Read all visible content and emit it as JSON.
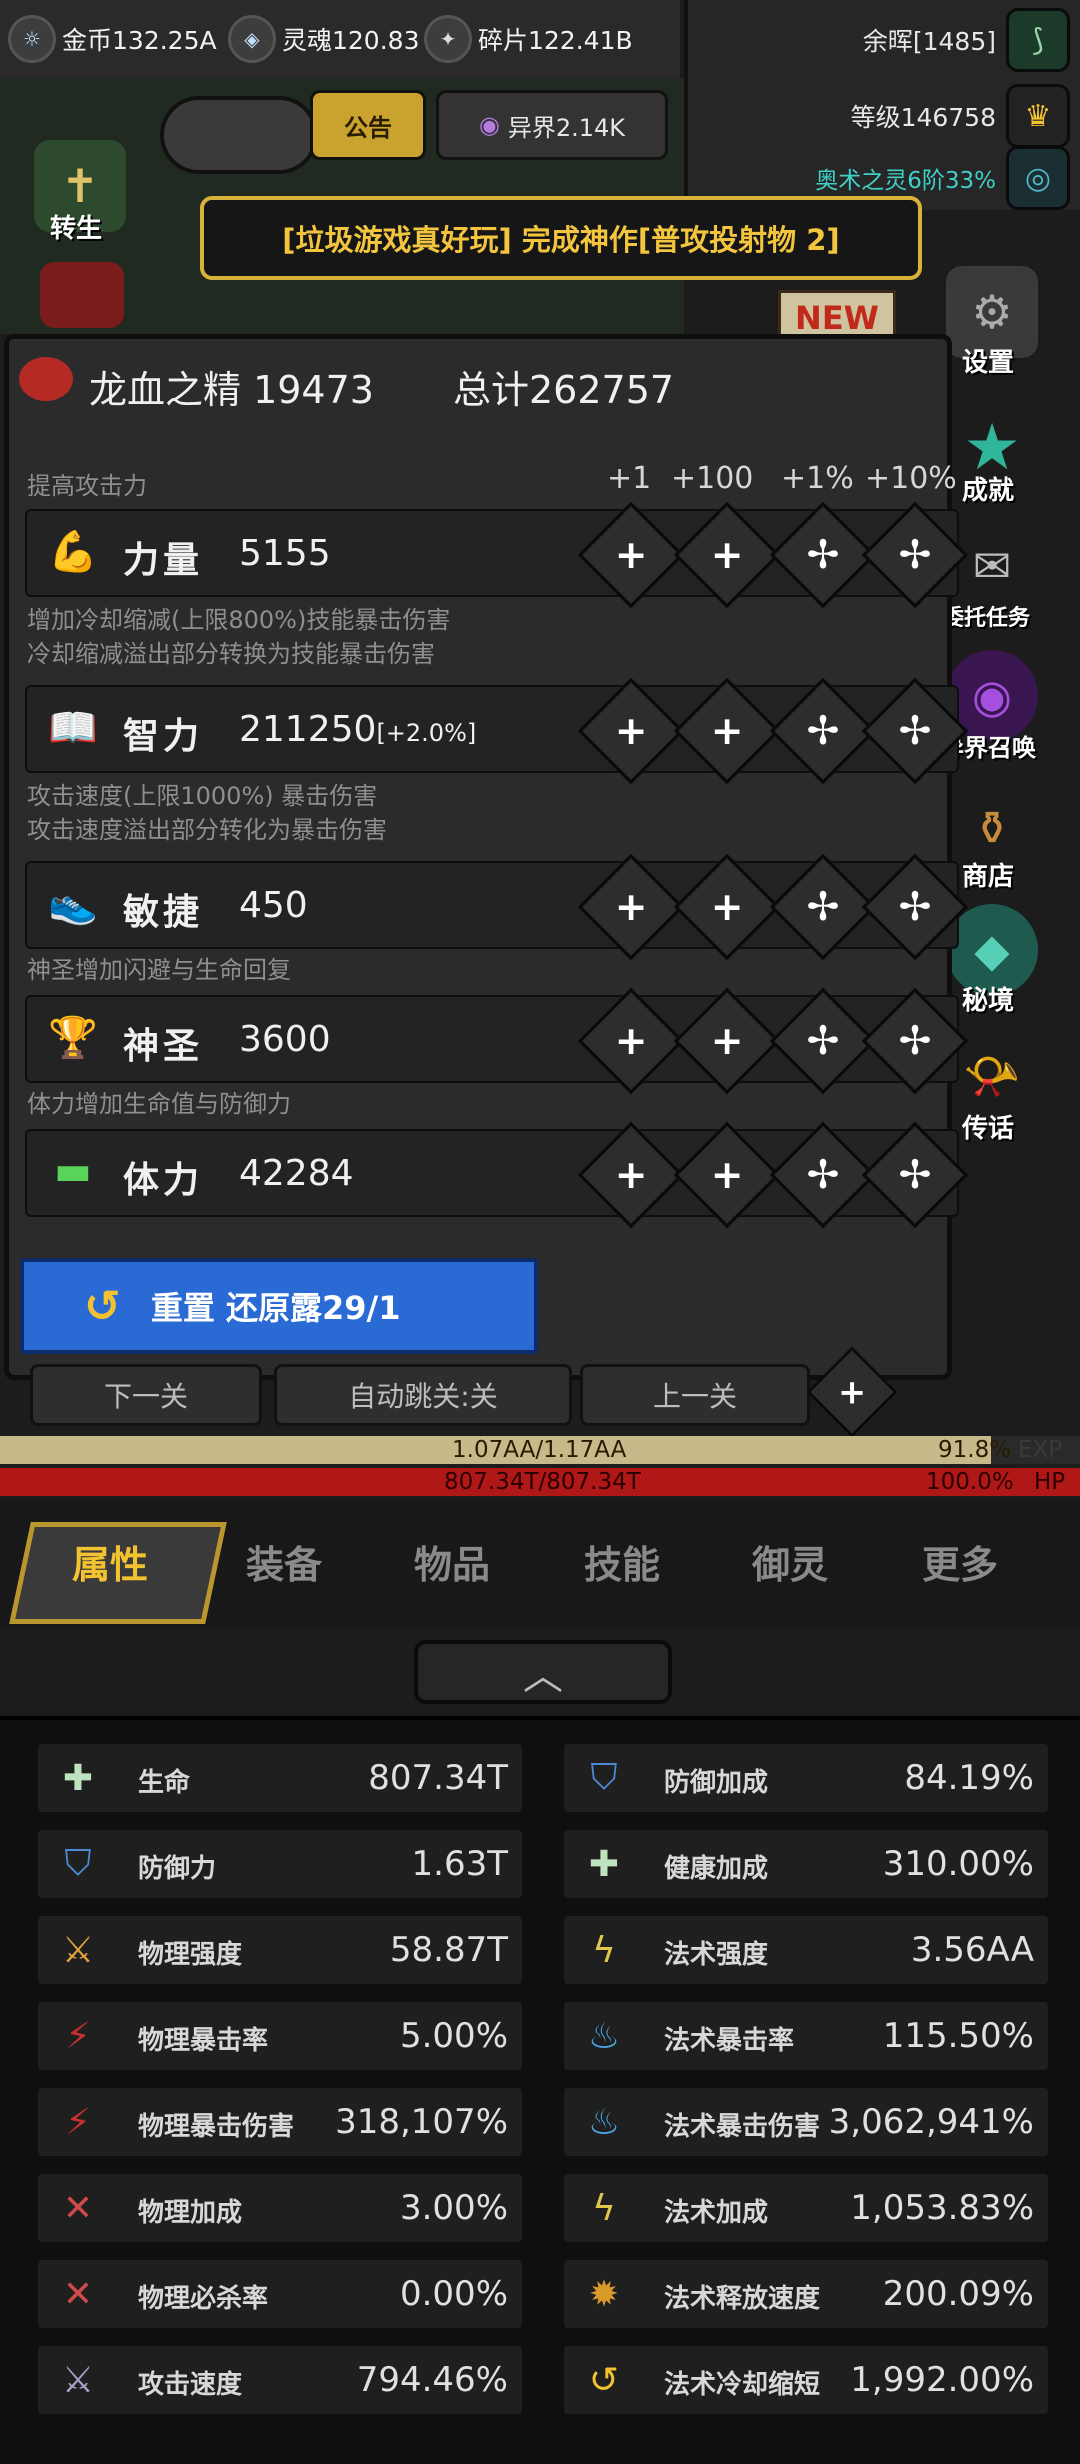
{
  "top": {
    "gold": "金币132.25A",
    "soul": "灵魂120.83",
    "fragment": "碎片122.41B",
    "notice_btn": "公告",
    "otherworld": "异界2.14K",
    "yuhui": "余晖[1485]",
    "level": "等级146758",
    "arcane": "奥术之灵6阶33%"
  },
  "banner": "[垃圾游戏真好玩] 完成神作[普攻投射物 2]",
  "side_left": {
    "rebirth": "转生"
  },
  "side_right": {
    "new_tag": "NEW",
    "settings": "设置",
    "achievement": "成就",
    "quest": "委托任务",
    "summon": "异界召唤",
    "shop": "商店",
    "secret": "秘境",
    "legend": "传话"
  },
  "panel": {
    "essence": "龙血之精 19473",
    "total": "总计262757",
    "hint_str": "提高攻击力",
    "col_labels": [
      "+1",
      "+100",
      "+1%",
      "+10%"
    ],
    "hint_int": [
      "增加冷却缩减(上限800%)技能暴击伤害",
      "冷却缩减溢出部分转换为技能暴击伤害"
    ],
    "hint_agi": [
      "攻击速度(上限1000%) 暴击伤害",
      "攻击速度溢出部分转化为暴击伤害"
    ],
    "hint_holy": "神圣增加闪避与生命回复",
    "hint_vit": "体力增加生命值与防御力",
    "stats": [
      {
        "name": "力量",
        "value": "5155",
        "extra": ""
      },
      {
        "name": "智力",
        "value": "211250",
        "extra": "[+2.0%]"
      },
      {
        "name": "敏捷",
        "value": "450",
        "extra": ""
      },
      {
        "name": "神圣",
        "value": "3600",
        "extra": ""
      },
      {
        "name": "体力",
        "value": "42284",
        "extra": ""
      }
    ],
    "reset": "重置 还原露29/1"
  },
  "level_nav": {
    "next": "下一关",
    "auto": "自动跳关:关",
    "prev": "上一关"
  },
  "bars": {
    "exp_text": "1.07AA/1.17AA",
    "exp_pct": "91.8%",
    "exp_label": "EXP",
    "exp_fill": 0.918,
    "hp_text": "807.34T/807.34T",
    "hp_pct": "100.0%",
    "hp_label": "HP",
    "hp_fill": 1.0
  },
  "tabs": [
    "属性",
    "装备",
    "物品",
    "技能",
    "御灵",
    "更多"
  ],
  "attributes": {
    "left": [
      {
        "name": "生命",
        "value": "807.34T"
      },
      {
        "name": "防御力",
        "value": "1.63T"
      },
      {
        "name": "物理强度",
        "value": "58.87T"
      },
      {
        "name": "物理暴击率",
        "value": "5.00%"
      },
      {
        "name": "物理暴击伤害",
        "value": "318,107%"
      },
      {
        "name": "物理加成",
        "value": "3.00%"
      },
      {
        "name": "物理必杀率",
        "value": "0.00%"
      },
      {
        "name": "攻击速度",
        "value": "794.46%"
      }
    ],
    "right": [
      {
        "name": "防御加成",
        "value": "84.19%"
      },
      {
        "name": "健康加成",
        "value": "310.00%"
      },
      {
        "name": "法术强度",
        "value": "3.56AA"
      },
      {
        "name": "法术暴击率",
        "value": "115.50%"
      },
      {
        "name": "法术暴击伤害",
        "value": "3,062,941%"
      },
      {
        "name": "法术加成",
        "value": "1,053.83%"
      },
      {
        "name": "法术释放速度",
        "value": "200.09%"
      },
      {
        "name": "法术冷却缩短",
        "value": "1,992.00%"
      }
    ]
  }
}
